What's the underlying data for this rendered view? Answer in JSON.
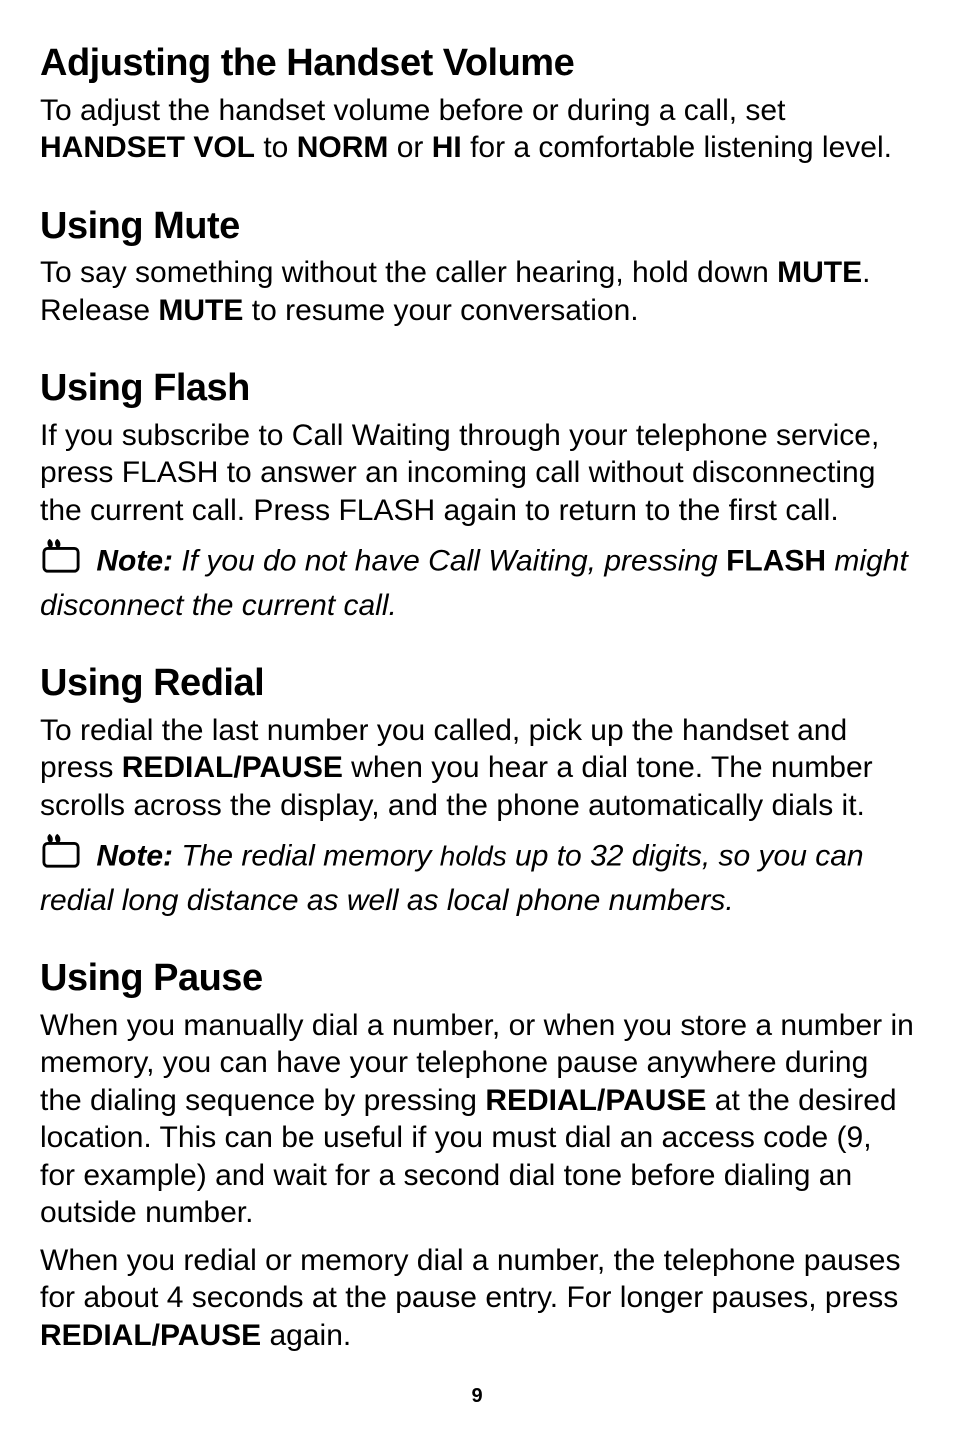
{
  "sections": {
    "adjust": {
      "heading": "Adjusting the Handset Volume",
      "body_pre": "To adjust the handset volume before or during a call, set ",
      "hv": "HANDSET VOL",
      "to": " to ",
      "norm": "NORM",
      "or": " or ",
      "hi": "HI",
      "body_post": " for a comfortable listening level."
    },
    "mute": {
      "heading": "Using Mute",
      "p1_pre": "To say something without the caller hearing, hold down ",
      "mute1": "MUTE",
      "p1_post": ". Release ",
      "mute2": "MUTE",
      "p1_end": " to resume your conversation."
    },
    "flash": {
      "heading": "Using Flash",
      "body": "If you subscribe to Call Waiting through your telephone service, press FLASH to answer an incoming call without disconnecting the current call. Press FLASH again to return to the first call.",
      "note_label": "Note:",
      "note_pre": " If you do not have Call Waiting, pressing ",
      "flash_b": "FLASH",
      "note_post": " might disconnect the current call."
    },
    "redial": {
      "heading": "Using Redial",
      "p_pre": "To redial the last number you called, pick up the handset and press ",
      "rp": "REDIAL/PAUSE",
      "p_post": " when you hear a dial tone. The number scrolls across the display, and the phone automatically dials it.",
      "note_label": "Note:",
      "note_pre": " The redial memory ",
      "note_holds": "holds",
      "note_post": " up to 32 digits, so you can redial long distance as well as local phone numbers."
    },
    "pause": {
      "heading": "Using Pause",
      "p1_pre": "When you manually dial a number, or when you store a number in memory, you can have your telephone pause anywhere during the dialing sequence by pressing ",
      "rp": "REDIAL/PAUSE",
      "p1_post": " at the desired location. This can be useful if you must dial an access code (9, for example) and wait for a second dial tone before dialing an outside number.",
      "p2_pre": "When you redial or memory dial a number, the telephone pauses for about 4 seconds at the pause entry. For longer pauses, press ",
      "rp2": "REDIAL/PAUSE",
      "p2_post": " again."
    }
  },
  "page_number": "9"
}
